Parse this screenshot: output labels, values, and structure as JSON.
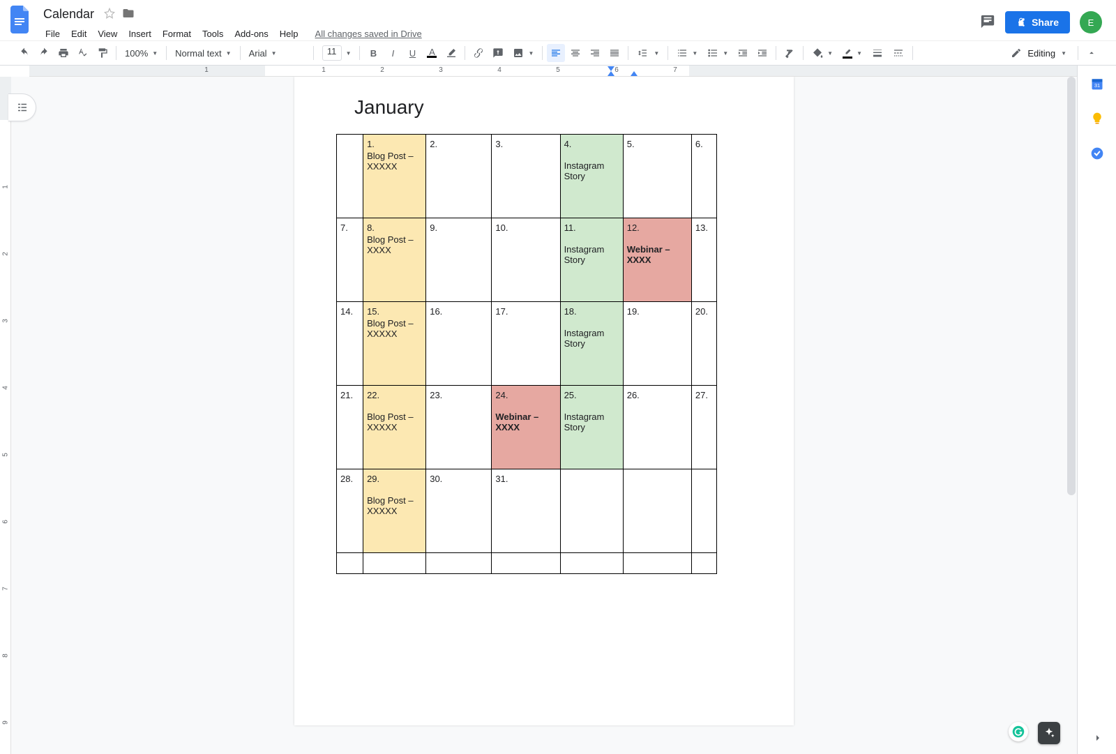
{
  "header": {
    "doc_title": "Calendar",
    "menus": {
      "file": "File",
      "edit": "Edit",
      "view": "View",
      "insert": "Insert",
      "format": "Format",
      "tools": "Tools",
      "addons": "Add-ons",
      "help": "Help"
    },
    "status": "All changes saved in Drive",
    "share_label": "Share",
    "avatar_letter": "E"
  },
  "toolbar": {
    "zoom": "100%",
    "style": "Normal text",
    "font": "Arial",
    "size": "11",
    "mode": "Editing"
  },
  "ruler": {
    "h_numbers": [
      "1",
      "2",
      "3",
      "4",
      "5",
      "6",
      "7"
    ],
    "v_numbers": [
      "1",
      "2",
      "3",
      "4",
      "5",
      "6",
      "7",
      "8",
      "9"
    ]
  },
  "doc": {
    "title": "January",
    "rows": [
      [
        {
          "num": "",
          "text": "",
          "cls": ""
        },
        {
          "num": "1.",
          "text": "Blog Post  – XXXXX",
          "cls": "yellow"
        },
        {
          "num": "2.",
          "text": "",
          "cls": ""
        },
        {
          "num": "3.",
          "text": "",
          "cls": ""
        },
        {
          "num": "4.",
          "text": "Instagram Story",
          "cls": "green",
          "gap": true
        },
        {
          "num": "5.",
          "text": "",
          "cls": ""
        },
        {
          "num": "6.",
          "text": "",
          "cls": ""
        }
      ],
      [
        {
          "num": "7.",
          "text": "",
          "cls": ""
        },
        {
          "num": "8.",
          "text": "Blog Post  – XXXX",
          "cls": "yellow"
        },
        {
          "num": "9.",
          "text": "",
          "cls": ""
        },
        {
          "num": "10.",
          "text": "",
          "cls": ""
        },
        {
          "num": "11.",
          "text": "Instagram Story",
          "cls": "green",
          "gap": true
        },
        {
          "num": "12.",
          "text": "Webinar – XXXX",
          "cls": "red",
          "gap": true,
          "bold": true
        },
        {
          "num": "13.",
          "text": "",
          "cls": ""
        }
      ],
      [
        {
          "num": "14.",
          "text": "",
          "cls": ""
        },
        {
          "num": "15.",
          "text": "Blog Post  – XXXXX",
          "cls": "yellow"
        },
        {
          "num": "16.",
          "text": "",
          "cls": ""
        },
        {
          "num": "17.",
          "text": "",
          "cls": ""
        },
        {
          "num": "18.",
          "text": "Instagram Story",
          "cls": "green",
          "gap": true
        },
        {
          "num": "19.",
          "text": "",
          "cls": ""
        },
        {
          "num": "20.",
          "text": "",
          "cls": ""
        }
      ],
      [
        {
          "num": "21.",
          "text": "",
          "cls": ""
        },
        {
          "num": "22.",
          "text": "Blog Post  – XXXXX",
          "cls": "yellow",
          "gap": true
        },
        {
          "num": "23.",
          "text": "",
          "cls": ""
        },
        {
          "num": "24.",
          "text": "Webinar – XXXX",
          "cls": "red",
          "gap": true,
          "bold": true
        },
        {
          "num": "25.",
          "text": "Instagram Story",
          "cls": "green",
          "gap": true
        },
        {
          "num": "26.",
          "text": "",
          "cls": ""
        },
        {
          "num": "27.",
          "text": "",
          "cls": ""
        }
      ],
      [
        {
          "num": "28.",
          "text": "",
          "cls": ""
        },
        {
          "num": "29.",
          "text": "Blog Post  – XXXXX",
          "cls": "yellow",
          "gap": true
        },
        {
          "num": "30.",
          "text": "",
          "cls": ""
        },
        {
          "num": "31.",
          "text": "",
          "cls": ""
        },
        {
          "num": "",
          "text": "",
          "cls": ""
        },
        {
          "num": "",
          "text": "",
          "cls": ""
        },
        {
          "num": "",
          "text": "",
          "cls": ""
        }
      ],
      [
        {
          "num": "",
          "text": "",
          "cls": ""
        },
        {
          "num": "",
          "text": "",
          "cls": ""
        },
        {
          "num": "",
          "text": "",
          "cls": ""
        },
        {
          "num": "",
          "text": "",
          "cls": ""
        },
        {
          "num": "",
          "text": "",
          "cls": ""
        },
        {
          "num": "",
          "text": "",
          "cls": ""
        },
        {
          "num": "",
          "text": "",
          "cls": ""
        }
      ]
    ]
  }
}
